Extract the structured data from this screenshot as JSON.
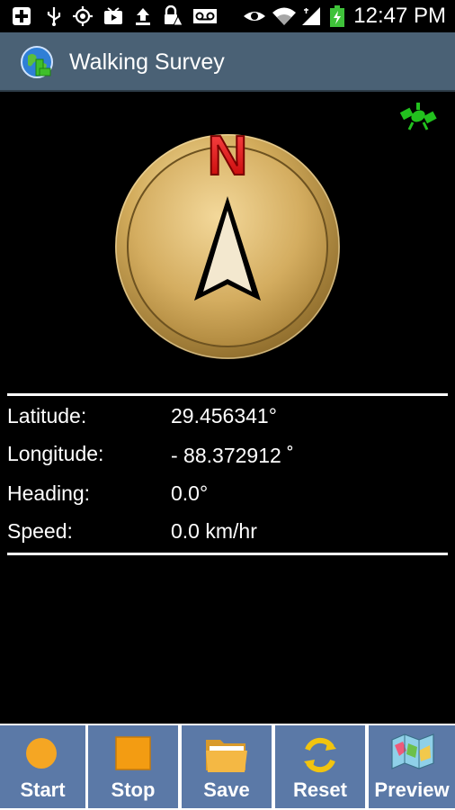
{
  "status_bar": {
    "time": "12:47 PM",
    "icons": [
      "add-icon",
      "usb-icon",
      "gps-icon",
      "youtube-icon",
      "upload-icon",
      "lock-alert-icon",
      "voicemail-icon",
      "eye-icon",
      "wifi-icon",
      "signal-icon",
      "battery-charging-icon"
    ]
  },
  "app": {
    "title": "Walking Survey",
    "icon": "globe-map-icon"
  },
  "compass": {
    "north_label": "N",
    "heading_deg": 0.0
  },
  "readings": {
    "latitude_label": "Latitude:",
    "latitude_value": "29.456341°",
    "longitude_label": "Longitude:",
    "longitude_value": "- 88.372912 ˚",
    "heading_label": "Heading:",
    "heading_value": "0.0°",
    "speed_label": "Speed:",
    "speed_value": "0.0 km/hr"
  },
  "toolbar": {
    "start_label": "Start",
    "stop_label": "Stop",
    "save_label": "Save",
    "reset_label": "Reset",
    "preview_label": "Preview"
  },
  "colors": {
    "action_bar": "#4a6175",
    "toolbar_button": "#5b79a7",
    "compass_gold": "#c9a24f",
    "north_red": "#e01010",
    "satellite_green": "#22c11e",
    "start_orange": "#f5a623"
  }
}
